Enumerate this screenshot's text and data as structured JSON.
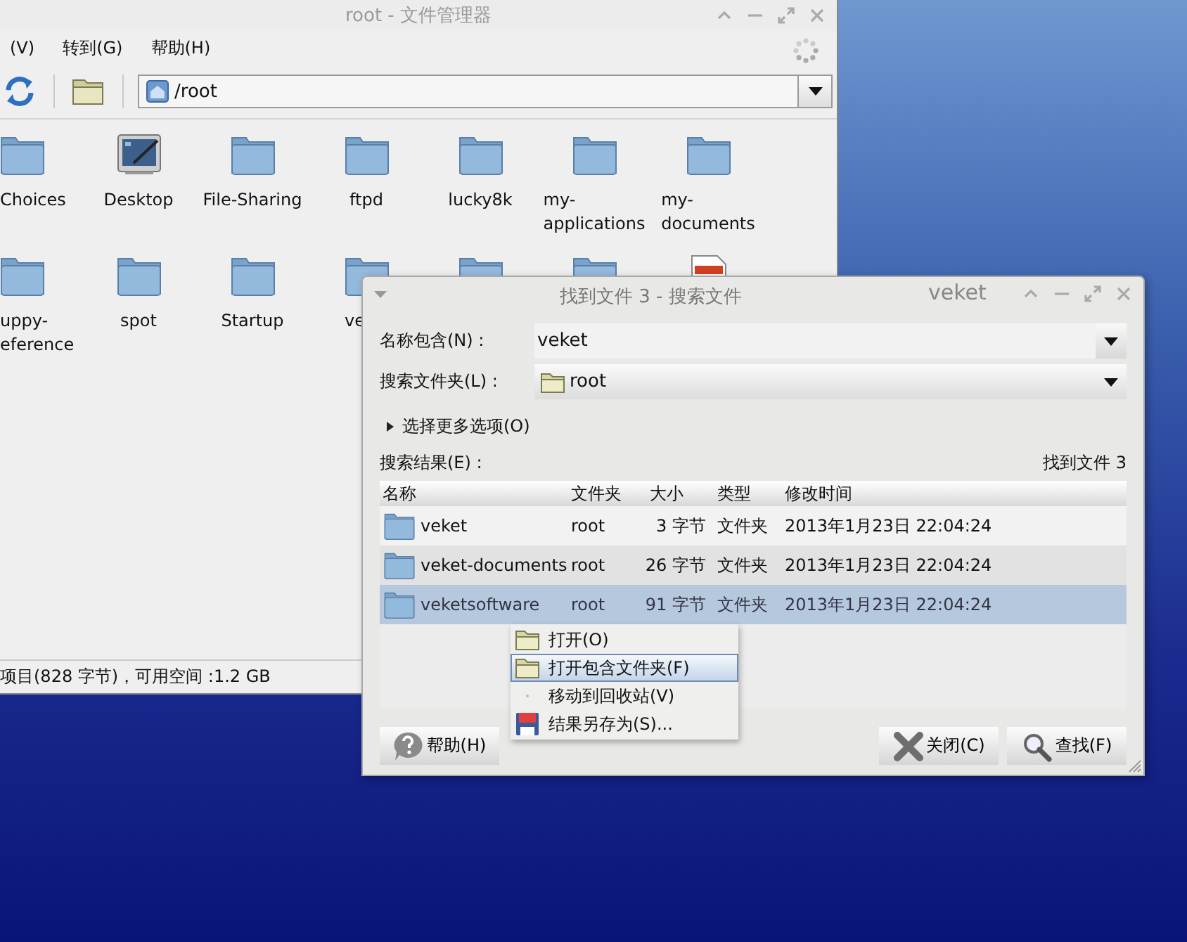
{
  "file_manager": {
    "title": "root - 文件管理器",
    "menu": [
      {
        "label": "(V)"
      },
      {
        "label": "转到(G)"
      },
      {
        "label": "帮助(H)"
      }
    ],
    "address": "/root",
    "items": [
      {
        "kind": "folder",
        "label": "Choices"
      },
      {
        "kind": "desktop",
        "label": "Desktop"
      },
      {
        "kind": "folder",
        "label": "File-Sharing"
      },
      {
        "kind": "folder",
        "label": "ftpd"
      },
      {
        "kind": "folder",
        "label": "lucky8k"
      },
      {
        "kind": "folder",
        "label": "my-\napplications"
      },
      {
        "kind": "folder",
        "label": "my-\ndocuments"
      },
      {
        "kind": "folder",
        "label": "uppy-\neference"
      },
      {
        "kind": "folder",
        "label": "spot"
      },
      {
        "kind": "folder",
        "label": "Startup"
      },
      {
        "kind": "folder",
        "label": "ve",
        "clipped": true
      },
      {
        "kind": "folder"
      },
      {
        "kind": "folder"
      },
      {
        "kind": "text_file"
      }
    ],
    "status_bar": "项目(828 字节)，可用空间 :1.2 GB"
  },
  "search_dialog": {
    "title": "找到文件 3 - 搜索文件",
    "host": "veket",
    "name_label": "名称包含(N) :",
    "name_value": "veket",
    "folder_label": "搜索文件夹(L) :",
    "folder_value": "root",
    "more_options": {
      "label": "选择更多选项(O)",
      "expanded": false
    },
    "results_label": "搜索结果(E) :",
    "results_count": "找到文件 3",
    "table": {
      "columns": [
        "名称",
        "文件夹",
        "大小",
        "类型",
        "修改时间"
      ],
      "rows": [
        {
          "name": "veket",
          "folder": "root",
          "size": "3 字节",
          "type": "文件夹",
          "modified": "2013年1月23日 22:04:24",
          "selected": false
        },
        {
          "name": "veket-documents",
          "folder": "root",
          "size": "26 字节",
          "type": "文件夹",
          "modified": "2013年1月23日 22:04:24",
          "selected": false
        },
        {
          "name": "veketsoftware",
          "folder": "root",
          "size": "91 字节",
          "type": "文件夹",
          "modified": "2013年1月23日 22:04:24",
          "selected": true
        }
      ]
    },
    "buttons": [
      {
        "kind": "help",
        "label": "帮助(H)"
      },
      {
        "kind": "close",
        "label": "关闭(C)"
      },
      {
        "kind": "find",
        "label": "查找(F)"
      }
    ]
  },
  "context_menu": {
    "items": [
      {
        "kind": "open",
        "label": "打开(O)",
        "selected": false
      },
      {
        "kind": "open",
        "label": "打开包含文件夹(F)",
        "selected": true
      },
      {
        "kind": "trash",
        "label": "移动到回收站(V)",
        "selected": false
      },
      {
        "kind": "save",
        "label": "结果另存为(S)...",
        "selected": false
      }
    ]
  }
}
